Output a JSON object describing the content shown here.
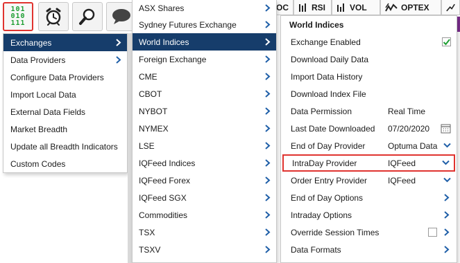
{
  "toolbar": {
    "binary_rows": [
      "101",
      "010",
      "111"
    ],
    "tabs": [
      "OC",
      "RSI",
      "VOL",
      "OPTEX"
    ],
    "accent_red": "#e0332f",
    "binary_green": "#1e9e33"
  },
  "main_menu": {
    "items": [
      {
        "label": "Exchanges",
        "active": true,
        "has_submenu": true
      },
      {
        "label": "Data Providers",
        "has_submenu": true
      },
      {
        "label": "Configure Data Providers"
      },
      {
        "label": "Import Local Data"
      },
      {
        "label": "External Data Fields"
      },
      {
        "label": "Market Breadth"
      },
      {
        "label": "Update all Breadth Indicators"
      },
      {
        "label": "Custom Codes"
      }
    ],
    "active_color": "#163d6b"
  },
  "exchange_menu": {
    "items": [
      {
        "label": "ASX Shares"
      },
      {
        "label": "Sydney Futures Exchange"
      },
      {
        "label": "World Indices",
        "active": true
      },
      {
        "label": "Foreign Exchange"
      },
      {
        "label": "CME"
      },
      {
        "label": "CBOT"
      },
      {
        "label": "NYBOT"
      },
      {
        "label": "NYMEX"
      },
      {
        "label": "LSE"
      },
      {
        "label": "IQFeed Indices"
      },
      {
        "label": "IQFeed Forex"
      },
      {
        "label": "IQFeed SGX"
      },
      {
        "label": "Commodities"
      },
      {
        "label": "TSX"
      },
      {
        "label": "TSXV"
      }
    ]
  },
  "indices_panel": {
    "title": "World Indices",
    "rows": [
      {
        "label": "Exchange Enabled",
        "control": "checkbox",
        "checked": true
      },
      {
        "label": "Download Daily Data"
      },
      {
        "label": "Import Data History"
      },
      {
        "label": "Download Index File"
      },
      {
        "label": "Data Permission",
        "value": "Real Time"
      },
      {
        "label": "Last Date Downloaded",
        "value": "07/20/2020",
        "control": "calendar"
      },
      {
        "label": "End of Day Provider",
        "value": "Optuma Data",
        "control": "dropdown"
      },
      {
        "label": "IntraDay Provider",
        "value": "IQFeed",
        "control": "dropdown",
        "highlighted": true
      },
      {
        "label": "Order Entry Provider",
        "value": "IQFeed",
        "control": "dropdown"
      },
      {
        "label": "End of Day Options",
        "control": "submenu"
      },
      {
        "label": "Intraday Options",
        "control": "submenu"
      },
      {
        "label": "Override Session Times",
        "control": "checkbox",
        "checked": false
      },
      {
        "label": "Data Formats",
        "control": "submenu"
      }
    ]
  }
}
